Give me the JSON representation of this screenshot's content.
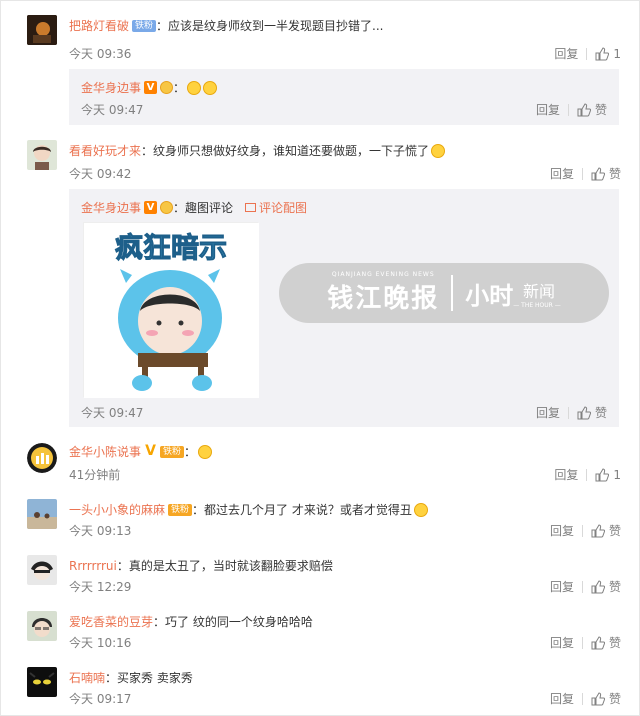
{
  "comments": [
    {
      "user": "把路灯看破",
      "fan_badge": "铁粉",
      "text": "：应该是纹身师纹到一半发现题目抄错了...",
      "time": "今天 09:36",
      "reply_label": "回复",
      "like_count": "1"
    },
    {
      "user": "看看好玩才来",
      "text": "：纹身师只想做好纹身，谁知道还要做题，一下子慌了",
      "time": "今天 09:42",
      "reply_label": "回复",
      "like_label": "赞"
    },
    {
      "user": "金华小陈说事",
      "fan_badge": "铁粉",
      "text": "：",
      "time": "41分钟前",
      "reply_label": "回复",
      "like_count": "1"
    },
    {
      "user": "一头小小象的麻麻",
      "fan_badge": "铁粉",
      "text": "：都过去几个月了 才来说？或者才觉得丑",
      "time": "今天 09:13",
      "reply_label": "回复",
      "like_label": "赞"
    },
    {
      "user": "Rrrrrrrui",
      "text": "：真的是太丑了，当时就该翻脸要求赔偿",
      "time": "今天 12:29",
      "reply_label": "回复",
      "like_label": "赞"
    },
    {
      "user": "爱吃香菜的豆芽",
      "text": "：巧了 纹的同一个纹身哈哈哈",
      "time": "今天 10:16",
      "reply_label": "回复",
      "like_label": "赞"
    },
    {
      "user": "石喃喃",
      "text": "：买家秀 卖家秀",
      "time": "今天 09:17",
      "reply_label": "回复",
      "like_label": "赞"
    }
  ],
  "replies": [
    {
      "user": "金华身边事",
      "text": "：",
      "time": "今天 09:47",
      "reply_label": "回复",
      "like_label": "赞"
    },
    {
      "user": "金华身边事",
      "text": "：趣图评论",
      "image_link": "评论配图",
      "time": "今天 09:47",
      "reply_label": "回复",
      "like_label": "赞"
    }
  ],
  "sticker": {
    "caption": "疯狂暗示"
  },
  "watermark": {
    "brand": "钱江晚报",
    "brand_small": "QIANJIANG EVENING NEWS",
    "right": "小时",
    "news": "新闻",
    "tagline": "— THE HOUR —"
  },
  "colors": {
    "username": "#eb7350",
    "meta": "#808080",
    "reply_bg": "#f2f2f5"
  }
}
